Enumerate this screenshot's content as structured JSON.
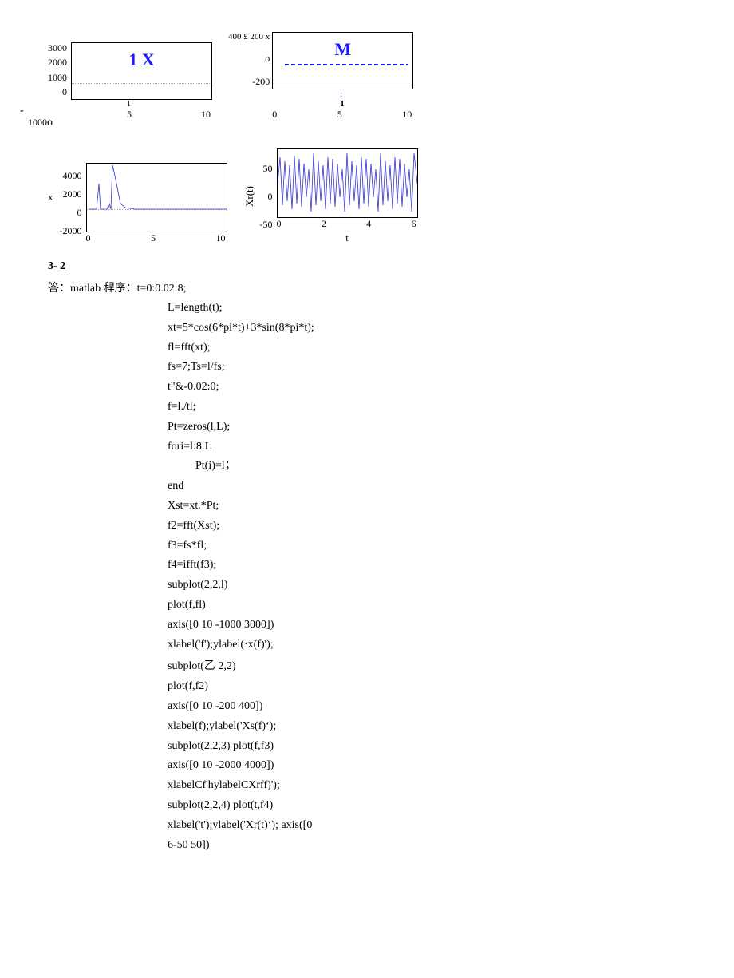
{
  "chart_data": [
    {
      "type": "line",
      "title": "1 X",
      "xlim": [
        0,
        10
      ],
      "ylim": [
        -1000,
        3000
      ],
      "y_ticks": [
        "3000",
        "2000",
        "1000",
        "0"
      ],
      "x_ticks_extra": [
        "1",
        "5",
        "10"
      ],
      "bottom_left_label": "1000",
      "small_o": "o",
      "small_dash": "-"
    },
    {
      "type": "line",
      "title": "M",
      "xlim": [
        0,
        10
      ],
      "ylim": [
        -200,
        400
      ],
      "y_prefix": "400 £ 200 x",
      "y_ticks": [
        "o",
        "-200"
      ],
      "x_ticks": [
        "0",
        "5",
        "10"
      ],
      "dot_marks": [
        ":",
        "1"
      ]
    },
    {
      "type": "line",
      "ylabel": "x",
      "xlim": [
        0,
        10
      ],
      "ylim": [
        -2000,
        4000
      ],
      "y_ticks": [
        "4000",
        "2000",
        "0",
        "-2000"
      ],
      "x_ticks": [
        "0",
        "5",
        "10"
      ]
    },
    {
      "type": "line",
      "ylabel": "Xr(t)",
      "xlabel": "t",
      "xlim": [
        0,
        6
      ],
      "ylim": [
        -50,
        50
      ],
      "y_ticks": [
        "50",
        "0",
        "-50"
      ],
      "x_ticks": [
        "0",
        "2",
        "4",
        "6"
      ]
    }
  ],
  "question": "3-  2",
  "answer_prefix": "答：matlab 稈序：",
  "code": [
    "t=0:0.02:8;",
    "L=length(t);",
    "xt=5*cos(6*pi*t)+3*sin(8*pi*t);",
    "fl=fft(xt);",
    "fs=7;Ts=l/fs;",
    "t\"&-0.02:0;",
    "f=l./tl;",
    "Pt=zeros(l,L);",
    "fori=l:8:L",
    "Pt(i)=l；",
    "end",
    "Xst=xt.*Pt;",
    "f2=fft(Xst);",
    "f3=fs*fl;",
    "f4=ifft(f3);",
    "subplot(2,2,l)",
    "plot(f,fl)",
    "axis([0 10 -1000 3000])",
    "xlabel('f');ylabel(·x(f)');",
    "subplot(乙  2,2)",
    "plot(f,f2)",
    "axis([0 10 -200 400])",
    "xlabel(f);ylabel('Xs(f)‘);",
    "subplot(2,2,3) plot(f,f3)",
    "axis([0 10 -2000 4000])",
    "xlabelCf'hylabelCXrff)');",
    "subplot(2,2,4) plot(t,f4)",
    "xlabel('t');ylabel('Xr(t)‘); axis([0",
    "6-50 50])"
  ]
}
